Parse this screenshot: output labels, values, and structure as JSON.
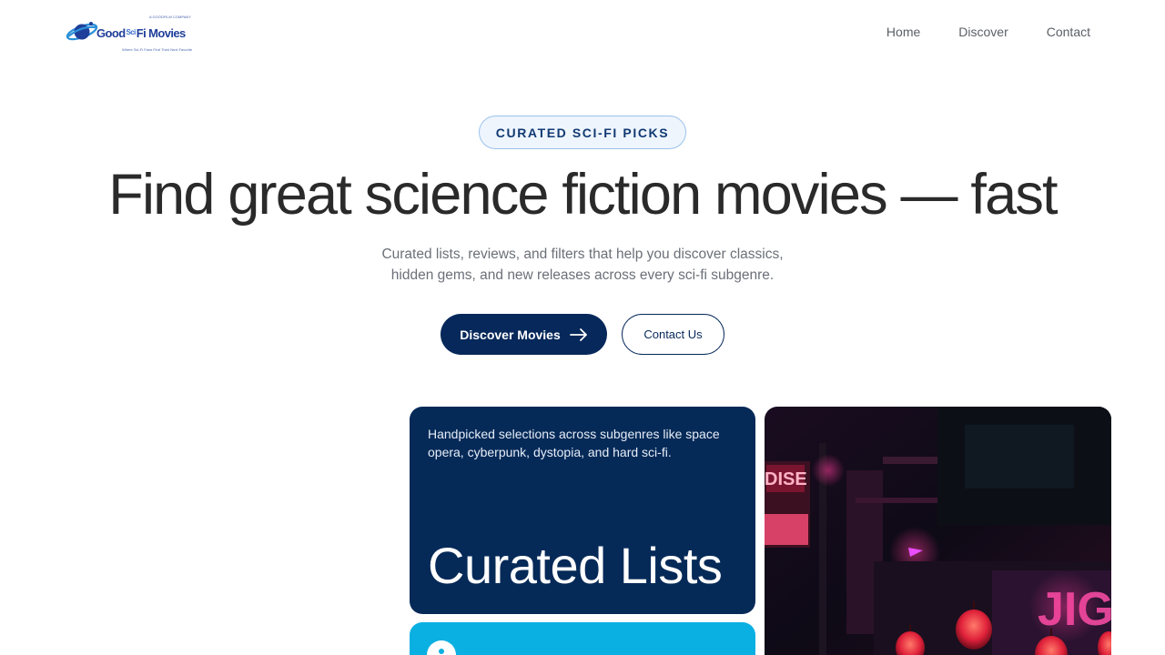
{
  "brand": {
    "name_left": "Good",
    "name_mid": "Sci",
    "name_right": "Fi Movies",
    "tagline_top": "A GOODFILM COMPANY",
    "tagline_bottom": "Where Sci-Fi Fans Find Their Next Favorite"
  },
  "nav": {
    "items": [
      "Home",
      "Discover",
      "Contact"
    ]
  },
  "hero": {
    "badge": "CURATED SCI-FI PICKS",
    "title": "Find great science fiction movies — fast",
    "subtitle_line1": "Curated lists, reviews, and filters that help you discover classics,",
    "subtitle_line2": "hidden gems, and new releases across every sci-fi subgenre.",
    "primary_button": "Discover Movies",
    "secondary_button": "Contact Us"
  },
  "cards": {
    "lists": {
      "description": "Handpicked selections across subgenres like space opera, cyberpunk, dystopia, and hard sci-fi.",
      "title": "Curated Lists"
    },
    "image": {
      "sign_text_1": "DISE",
      "sign_text_2": "JIG"
    }
  },
  "colors": {
    "navy": "#06285a",
    "cyan": "#0bb0e2",
    "badge_bg": "#eef5fd",
    "badge_border": "#9cc3ec"
  }
}
